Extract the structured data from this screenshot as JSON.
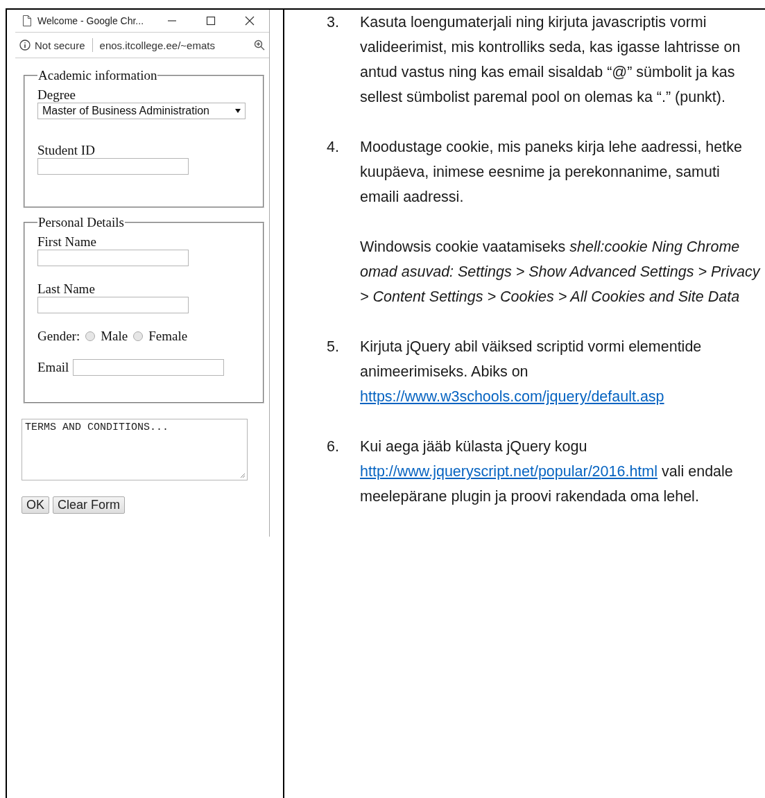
{
  "browser": {
    "title": "Welcome - Google Chr...",
    "security": "Not secure",
    "url": "enos.itcollege.ee/~emats"
  },
  "form": {
    "fieldsets": [
      {
        "legend": "Academic information",
        "fields": [
          {
            "kind": "select",
            "label": "Degree",
            "value": "Master of Business Administration"
          },
          {
            "kind": "text",
            "label": "Student ID"
          }
        ]
      },
      {
        "legend": "Personal Details",
        "fields": [
          {
            "kind": "text",
            "label": "First Name"
          },
          {
            "kind": "text",
            "label": "Last Name"
          },
          {
            "kind": "radio",
            "label": "Gender:",
            "options": [
              {
                "label": "Male",
                "selected": false
              },
              {
                "label": "Female",
                "selected": false
              }
            ]
          },
          {
            "kind": "inline",
            "label": "Email"
          }
        ]
      }
    ],
    "terms": {
      "value": "TERMS AND CONDITIONS..."
    },
    "buttons": [
      "OK",
      "Clear Form"
    ]
  },
  "instructions": [
    {
      "number": "3.",
      "paragraphs": [
        {
          "text": "Kasuta loengumaterjali ning kirjuta javascriptis vormi valideerimist, mis kontrolliks seda, kas igasse lahtrisse on antud vastus ning kas email sisaldab “@” sümbolit ja kas sellest sümbolist paremal pool on olemas ka “.” (punkt)."
        }
      ]
    },
    {
      "number": "4.",
      "paragraphs": [
        {
          "text": "Moodustage cookie, mis paneks kirja lehe aadressi, hetke kuupäeva, inimese eesnime ja perekonnanime, samuti emaili aadressi."
        },
        {
          "text": "Windowsis cookie vaatamiseks *shell:cookie Ning Chrome omad asuvad: Settings > Show Advanced Settings > Privacy > Content Settings > Cookies > All Cookies and Site Data*"
        }
      ]
    },
    {
      "number": "5.",
      "paragraphs": [
        {
          "text": "Kirjuta jQuery abil väiksed scriptid vormi elementide animeerimiseks. Abiks on",
          "link": "https://www.w3schools.com/jquery/default.asp"
        }
      ]
    },
    {
      "number": "6.",
      "paragraphs": [
        {
          "text": "Kui aega jääb külasta jQuery kogu",
          "link": "http://www.jqueryscript.net/popular/2016.html",
          "after": "vali endale meelepärane plugin ja proovi rakendada oma lehel."
        }
      ]
    }
  ]
}
